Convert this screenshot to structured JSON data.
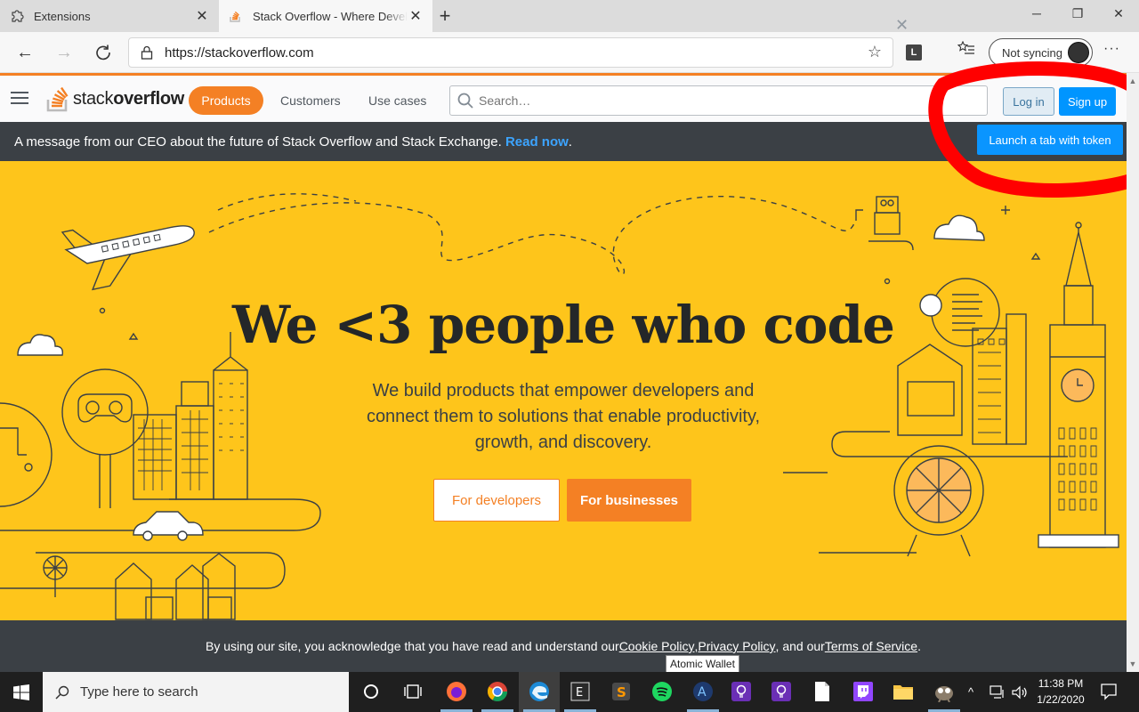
{
  "browser": {
    "tabs": [
      {
        "title": "Extensions",
        "icon": "extension-puzzle-icon",
        "active": false
      },
      {
        "title": "Stack Overflow - Where Developers Learn",
        "icon": "stackoverflow-favicon",
        "active": true
      }
    ],
    "new_tab": "+",
    "window_controls": {
      "minimize": "─",
      "restore": "❐",
      "close": "✕"
    },
    "url": "https://stackoverflow.com",
    "extension_label": "L",
    "sync_label": "Not syncing",
    "more_label": "···"
  },
  "so_header": {
    "logo_light": "stack",
    "logo_bold": "overflow",
    "products": "Products",
    "customers": "Customers",
    "use_cases": "Use cases",
    "search_placeholder": "Search…",
    "login": "Log in",
    "signup": "Sign up"
  },
  "announcement": {
    "text": "A message from our CEO about the future of Stack Overflow and Stack Exchange. ",
    "link": "Read now",
    "suffix": ".",
    "launch_button": "Launch a tab with token"
  },
  "hero": {
    "title": "We <3 people who code",
    "subtitle": "We build products that empower developers and connect them to solutions that enable productivity, growth, and discovery.",
    "btn_developers": "For developers",
    "btn_businesses": "For businesses"
  },
  "cookie": {
    "prefix": "By using our site, you acknowledge that you have read and understand our ",
    "cookie_policy": "Cookie Policy",
    "sep1": ", ",
    "privacy_policy": "Privacy Policy",
    "sep2": ", and our ",
    "terms": "Terms of Service",
    "suffix": ".",
    "close": "✕"
  },
  "tooltip": "Atomic Wallet",
  "taskbar": {
    "search_placeholder": "Type here to search",
    "time": "11:38 PM",
    "date": "1/22/2020",
    "apps": [
      "cortana-icon",
      "task-view-icon",
      "firefox-icon",
      "chrome-icon",
      "edge-icon",
      "app-icon",
      "sublime-icon",
      "spotify-icon",
      "atomic-wallet-icon",
      "bulb-icon",
      "bulb-icon",
      "file-icon",
      "twitch-icon",
      "folder-icon",
      "gimp-icon"
    ]
  },
  "colors": {
    "so_orange": "#f48024",
    "hero_yellow": "#fec51b",
    "dark_bar": "#3b4045",
    "link_blue": "#3ca4ff",
    "annotation_red": "#ff0000"
  }
}
